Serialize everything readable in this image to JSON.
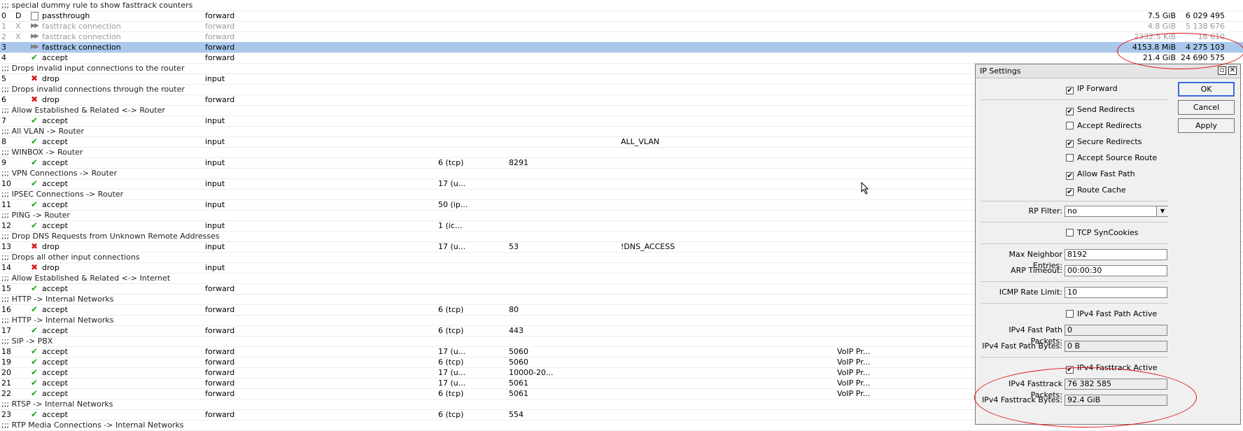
{
  "rows": [
    {
      "kind": "comment",
      "text": ";;; special dummy rule to show fasttrack counters"
    },
    {
      "kind": "rule",
      "num": "0",
      "flag": "D",
      "icon": "passthrough",
      "action": "passthrough",
      "chain": "forward",
      "bytes": "7.5 GiB",
      "packets": "6 029 495"
    },
    {
      "kind": "rule",
      "num": "1",
      "flag": "X",
      "icon": "fasttrack",
      "action": "fasttrack connection",
      "chain": "forward",
      "bytes": "4.8 GiB",
      "packets": "5 138 676",
      "disabled": true
    },
    {
      "kind": "rule",
      "num": "2",
      "flag": "X",
      "icon": "fasttrack",
      "action": "fasttrack connection",
      "chain": "forward",
      "bytes": "2332.5 KiB",
      "packets": "16 610",
      "disabled": true
    },
    {
      "kind": "rule",
      "num": "3",
      "flag": "",
      "icon": "fasttrack",
      "action": "fasttrack connection",
      "chain": "forward",
      "bytes": "4153.8 MiB",
      "packets": "4 275 103",
      "selected": true
    },
    {
      "kind": "rule",
      "num": "4",
      "flag": "",
      "icon": "accept",
      "action": "accept",
      "chain": "forward",
      "bytes": "21.4 GiB",
      "packets": "24 690 575"
    },
    {
      "kind": "comment",
      "text": ";;; Drops invalid input connections to the router"
    },
    {
      "kind": "rule",
      "num": "5",
      "icon": "drop",
      "action": "drop",
      "chain": "input"
    },
    {
      "kind": "comment",
      "text": ";;; Drops invalid connections through the router"
    },
    {
      "kind": "rule",
      "num": "6",
      "icon": "drop",
      "action": "drop",
      "chain": "forward"
    },
    {
      "kind": "comment",
      "text": ";;; Allow Established & Related <-> Router"
    },
    {
      "kind": "rule",
      "num": "7",
      "icon": "accept",
      "action": "accept",
      "chain": "input"
    },
    {
      "kind": "comment",
      "text": ";;; All VLAN -> Router"
    },
    {
      "kind": "rule",
      "num": "8",
      "icon": "accept",
      "action": "accept",
      "chain": "input",
      "list": "ALL_VLAN"
    },
    {
      "kind": "comment",
      "text": ";;; WINBOX -> Router"
    },
    {
      "kind": "rule",
      "num": "9",
      "icon": "accept",
      "action": "accept",
      "chain": "input",
      "proto": "6 (tcp)",
      "port": "8291"
    },
    {
      "kind": "comment",
      "text": ";;; VPN Connections -> Router"
    },
    {
      "kind": "rule",
      "num": "10",
      "icon": "accept",
      "action": "accept",
      "chain": "input",
      "proto": "17 (u..."
    },
    {
      "kind": "comment",
      "text": ";;; IPSEC Connections -> Router"
    },
    {
      "kind": "rule",
      "num": "11",
      "icon": "accept",
      "action": "accept",
      "chain": "input",
      "proto": "50 (ip..."
    },
    {
      "kind": "comment",
      "text": ";;; PING -> Router"
    },
    {
      "kind": "rule",
      "num": "12",
      "icon": "accept",
      "action": "accept",
      "chain": "input",
      "proto": "1 (ic..."
    },
    {
      "kind": "comment",
      "text": ";;; Drop DNS Requests from Unknown Remote Addresses"
    },
    {
      "kind": "rule",
      "num": "13",
      "icon": "drop",
      "action": "drop",
      "chain": "input",
      "proto": "17 (u...",
      "port": "53",
      "list": "!DNS_ACCESS"
    },
    {
      "kind": "comment",
      "text": ";;; Drops all other input connections"
    },
    {
      "kind": "rule",
      "num": "14",
      "icon": "drop",
      "action": "drop",
      "chain": "input"
    },
    {
      "kind": "comment",
      "text": ";;; Allow Established & Related <-> Internet"
    },
    {
      "kind": "rule",
      "num": "15",
      "icon": "accept",
      "action": "accept",
      "chain": "forward"
    },
    {
      "kind": "comment",
      "text": ";;; HTTP -> Internal Networks"
    },
    {
      "kind": "rule",
      "num": "16",
      "icon": "accept",
      "action": "accept",
      "chain": "forward",
      "proto": "6 (tcp)",
      "port": "80"
    },
    {
      "kind": "comment",
      "text": ";;; HTTP -> Internal Networks"
    },
    {
      "kind": "rule",
      "num": "17",
      "icon": "accept",
      "action": "accept",
      "chain": "forward",
      "proto": "6 (tcp)",
      "port": "443"
    },
    {
      "kind": "comment",
      "text": ";;; SIP -> PBX"
    },
    {
      "kind": "rule",
      "num": "18",
      "icon": "accept",
      "action": "accept",
      "chain": "forward",
      "proto": "17 (u...",
      "port": "5060",
      "svc": "VoIP Pr..."
    },
    {
      "kind": "rule",
      "num": "19",
      "icon": "accept",
      "action": "accept",
      "chain": "forward",
      "proto": "6 (tcp)",
      "port": "5060",
      "svc": "VoIP Pr..."
    },
    {
      "kind": "rule",
      "num": "20",
      "icon": "accept",
      "action": "accept",
      "chain": "forward",
      "proto": "17 (u...",
      "port": "10000-20...",
      "svc": "VoIP Pr..."
    },
    {
      "kind": "rule",
      "num": "21",
      "icon": "accept",
      "action": "accept",
      "chain": "forward",
      "proto": "17 (u...",
      "port": "5061",
      "svc": "VoIP Pr..."
    },
    {
      "kind": "rule",
      "num": "22",
      "icon": "accept",
      "action": "accept",
      "chain": "forward",
      "proto": "6 (tcp)",
      "port": "5061",
      "svc": "VoIP Pr..."
    },
    {
      "kind": "comment",
      "text": ";;; RTSP -> Internal Networks"
    },
    {
      "kind": "rule",
      "num": "23",
      "icon": "accept",
      "action": "accept",
      "chain": "forward",
      "proto": "6 (tcp)",
      "port": "554"
    },
    {
      "kind": "comment",
      "text": ";;; RTP Media Connections -> Internal Networks"
    }
  ],
  "dialog": {
    "title": "IP Settings",
    "ok": "OK",
    "cancel": "Cancel",
    "apply": "Apply",
    "ip_forward": {
      "label": "IP Forward",
      "checked": true
    },
    "send_redirects": {
      "label": "Send Redirects",
      "checked": true
    },
    "accept_redirects": {
      "label": "Accept Redirects",
      "checked": false
    },
    "secure_redirects": {
      "label": "Secure Redirects",
      "checked": true
    },
    "accept_source_route": {
      "label": "Accept Source Route",
      "checked": false
    },
    "allow_fast_path": {
      "label": "Allow Fast Path",
      "checked": true
    },
    "route_cache": {
      "label": "Route Cache",
      "checked": true
    },
    "rp_filter": {
      "label": "RP Filter:",
      "value": "no"
    },
    "tcp_syncookies": {
      "label": "TCP SynCookies",
      "checked": false
    },
    "max_neighbor": {
      "label": "Max Neighbor Entries:",
      "value": "8192"
    },
    "arp_timeout": {
      "label": "ARP Timeout:",
      "value": "00:00:30"
    },
    "icmp_rate": {
      "label": "ICMP Rate Limit:",
      "value": "10"
    },
    "fast_path_active": {
      "label": "IPv4 Fast Path Active",
      "checked": false
    },
    "fast_path_packets": {
      "label": "IPv4 Fast Path Packets:",
      "value": "0"
    },
    "fast_path_bytes": {
      "label": "IPv4 Fast Path Bytes:",
      "value": "0 B"
    },
    "fasttrack_active": {
      "label": "IPv4 Fasttrack Active",
      "checked": true
    },
    "fasttrack_packets": {
      "label": "IPv4 Fasttrack Packets:",
      "value": "76 382 585"
    },
    "fasttrack_bytes": {
      "label": "IPv4 Fasttrack Bytes:",
      "value": "92.4 GiB"
    }
  },
  "colors": {
    "highlight_ellipse": "#e01010",
    "selected_row": "#a9c8ec",
    "accept_icon": "#1aa61a",
    "drop_icon": "#d51a1a"
  },
  "icons": {
    "accept": "check-icon",
    "drop": "x-icon",
    "fasttrack": "double-arrow-icon",
    "passthrough": "document-icon",
    "dropdown": "triangle-down-icon",
    "close": "close-icon",
    "restore": "restore-icon"
  }
}
